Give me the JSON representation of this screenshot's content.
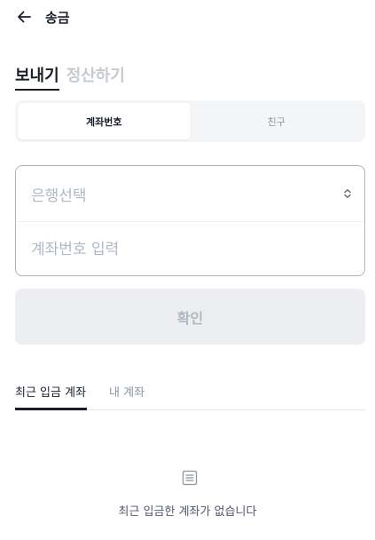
{
  "header": {
    "back_icon": "arrow-left-icon",
    "title": "송금"
  },
  "mode_tabs": [
    {
      "label": "보내기",
      "active": true
    },
    {
      "label": "정산하기",
      "active": false
    }
  ],
  "segment": [
    {
      "label": "계좌번호",
      "active": true
    },
    {
      "label": "친구",
      "active": false
    }
  ],
  "form": {
    "bank_placeholder": "은행선택",
    "bank_icon": "chevron-updown-icon",
    "account_placeholder": "계좌번호 입력"
  },
  "confirm_label": "확인",
  "list_tabs": [
    {
      "label": "최근 입금 계좌",
      "active": true
    },
    {
      "label": "내 계좌",
      "active": false
    }
  ],
  "empty": {
    "icon": "list-icon",
    "text": "최근 입금한 계좌가 없습니다"
  },
  "colors": {
    "text_primary": "#191f28",
    "text_muted": "#b0b8c1",
    "button_disabled_bg": "#eceef1",
    "segment_bg": "#f4f5f7"
  }
}
